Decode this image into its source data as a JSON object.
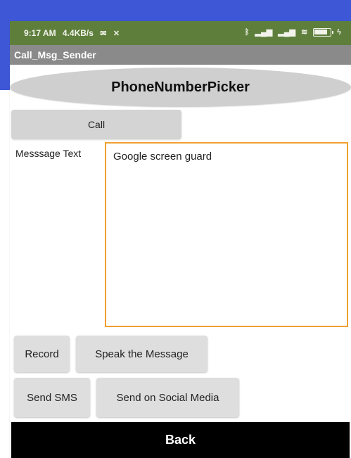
{
  "status_bar": {
    "time": "9:17 AM",
    "speed": "4.4KB/s",
    "battery": "100",
    "icons": [
      "mail-icon",
      "close-icon",
      "bluetooth-icon",
      "signal-icon",
      "signal-icon-2",
      "wifi-icon",
      "battery-icon",
      "charging-icon"
    ]
  },
  "app": {
    "title": "Call_Msg_Sender"
  },
  "picker": {
    "label": "PhoneNumberPicker"
  },
  "call": {
    "label": "Call"
  },
  "message": {
    "label": "Messsage Text",
    "value": "Google screen guard"
  },
  "buttons": {
    "record": "Record",
    "speak": "Speak the Message",
    "send_sms": "Send SMS",
    "send_social": "Send on Social Media",
    "back": "Back"
  },
  "colors": {
    "accent_blue": "#3e57d6",
    "status_bar": "#5e7f3c",
    "title_bar": "#8a8a8a",
    "textbox_border": "#f0a030",
    "back_button": "#000000"
  }
}
